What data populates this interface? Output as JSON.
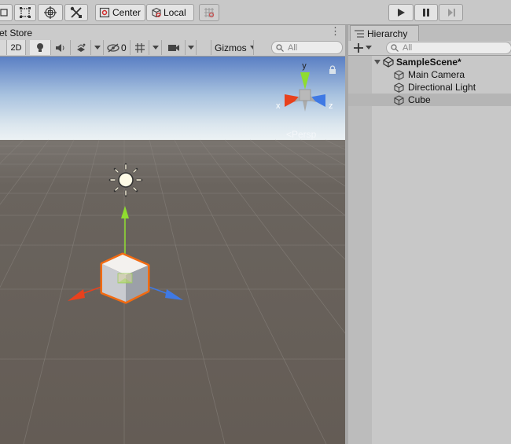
{
  "toolbar": {
    "pivot_label": "Center",
    "space_label": "Local",
    "play_icon": "play-icon",
    "pause_icon": "pause-icon",
    "step_icon": "step-icon"
  },
  "scene": {
    "tab_title": "et Store",
    "mode_2d": "2D",
    "hidden_count": "0",
    "gizmos_label": "Gizmos",
    "search_placeholder": "All",
    "persp_label": "<Persp",
    "axis_y": "y",
    "axis_x": "x",
    "axis_z": "z"
  },
  "hierarchy": {
    "tab_title": "Hierarchy",
    "search_placeholder": "All",
    "scene_name": "SampleScene*",
    "items": [
      {
        "label": "Main Camera"
      },
      {
        "label": "Directional Light"
      },
      {
        "label": "Cube"
      }
    ],
    "selected_index": 2
  },
  "colors": {
    "toolbar_bg": "#c8c8c8",
    "panel_bg": "#cbcbcb",
    "sky_top": "#5f83c9",
    "horizon": "#e6eef4",
    "ground": "#666058",
    "selection_outline": "#f26b12",
    "row_selected": "#b7b7b7"
  }
}
